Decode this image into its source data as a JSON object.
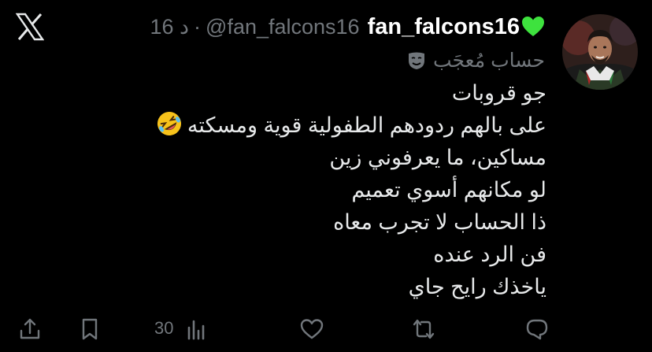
{
  "tweet": {
    "user": {
      "display_name": "fan_falcons16",
      "handle": "@fan_falcons16",
      "separator": "·",
      "time": "16 د",
      "label": "حساب مُعجَب"
    },
    "lines": [
      "جو قروبات",
      "على بالهم ردودهم الطفولية قوية ومسكته",
      "مساكين، ما يعرفوني زين",
      "لو مكانهم أسوي تعميم",
      "ذا الحساب لا تجرب معاه",
      "فن الرد عنده",
      "ياخذك رايح جاي"
    ],
    "emoji": "rolling-on-floor-laughing",
    "actions": {
      "views_count": "30"
    }
  },
  "icons": {
    "platform": "x-logo-icon",
    "badge": "green-heart-icon",
    "label_icon": "performing-arts-mask-icon",
    "share": "share-icon",
    "bookmark": "bookmark-icon",
    "views": "views-chart-icon",
    "like": "heart-outline-icon",
    "retweet": "retweet-icon",
    "reply": "reply-icon"
  },
  "colors": {
    "background": "#000000",
    "primary_text": "#e7e9ea",
    "secondary_text": "#71767b",
    "badge_heart": "#3ee23e"
  }
}
